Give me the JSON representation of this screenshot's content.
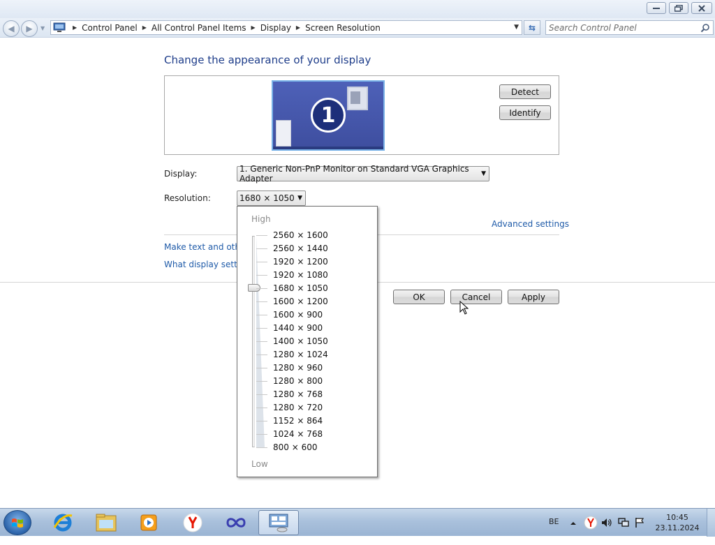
{
  "window": {
    "minimize_icon": "minimize-icon",
    "maximize_icon": "restore-icon",
    "close_icon": "close-icon"
  },
  "address_bar": {
    "crumbs": [
      "Control Panel",
      "All Control Panel Items",
      "Display",
      "Screen Resolution"
    ],
    "search_placeholder": "Search Control Panel"
  },
  "main": {
    "heading": "Change the appearance of your display",
    "monitor_number": "1",
    "detect_label": "Detect",
    "identify_label": "Identify",
    "display_label": "Display:",
    "display_value": "1. Generic Non-PnP Monitor on Standard VGA Graphics Adapter",
    "resolution_label": "Resolution:",
    "resolution_value": "1680 × 1050",
    "advanced_link": "Advanced settings",
    "link_text_size": "Make text and other",
    "link_what_settings": "What display setting",
    "ok_label": "OK",
    "cancel_label": "Cancel",
    "apply_label": "Apply"
  },
  "resolution_dropdown": {
    "high_label": "High",
    "low_label": "Low",
    "selected": "1680 × 1050",
    "options": [
      "2560 × 1600",
      "2560 × 1440",
      "1920 × 1200",
      "1920 × 1080",
      "1680 × 1050",
      "1600 × 1200",
      "1600 × 900",
      "1440 × 900",
      "1400 × 1050",
      "1280 × 1024",
      "1280 × 960",
      "1280 × 800",
      "1280 × 768",
      "1280 × 720",
      "1152 × 864",
      "1024 × 768",
      "800 × 600"
    ]
  },
  "taskbar": {
    "items": [
      "internet-explorer-icon",
      "windows-explorer-icon",
      "media-player-icon",
      "yandex-browser-icon",
      "infinity-app-icon",
      "control-panel-display-icon"
    ],
    "language": "BE",
    "time": "10:45",
    "date": "23.11.2024"
  },
  "colors": {
    "heading": "#1e3d8a",
    "link": "#1e5aa8",
    "taskbar": "#aac1dc"
  }
}
